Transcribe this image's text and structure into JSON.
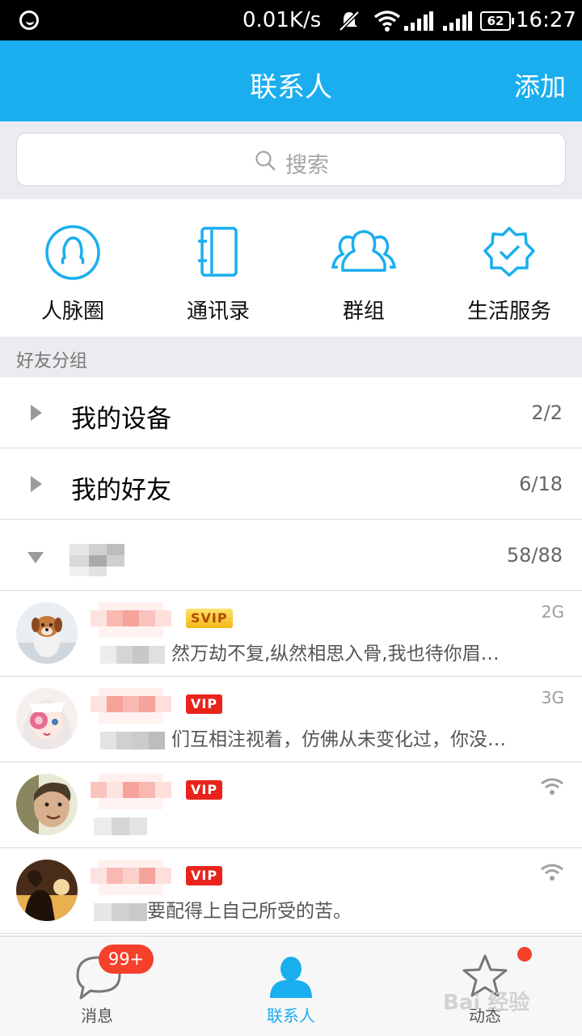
{
  "status_bar": {
    "net_speed": "0.01K/s",
    "battery": "62",
    "time": "16:27"
  },
  "header": {
    "title": "联系人",
    "add_label": "添加"
  },
  "search": {
    "placeholder": "搜索"
  },
  "quick_entries": [
    {
      "label": "人脉圈",
      "icon": "person-circle-icon"
    },
    {
      "label": "通讯录",
      "icon": "address-book-icon"
    },
    {
      "label": "群组",
      "icon": "group-icon"
    },
    {
      "label": "生活服务",
      "icon": "verified-badge-icon"
    }
  ],
  "section": {
    "title": "好友分组"
  },
  "groups": [
    {
      "name": "我的设备",
      "count": "2/2",
      "expanded": false
    },
    {
      "name": "我的好友",
      "count": "6/18",
      "expanded": false
    },
    {
      "name": "",
      "count": "58/88",
      "expanded": true
    }
  ],
  "contacts": [
    {
      "badge": "SVIP",
      "network": "2G",
      "signature": "然万劫不复,纵然相思入骨,我也待你眉…"
    },
    {
      "badge": "VIP",
      "network": "3G",
      "signature": "们互相注视着，仿佛从未变化过，你没…"
    },
    {
      "badge": "VIP",
      "network": "wifi",
      "signature": ""
    },
    {
      "badge": "VIP",
      "network": "wifi",
      "signature": "要配得上自己所受的苦。"
    }
  ],
  "bottom_nav": {
    "tabs": [
      {
        "label": "消息",
        "icon": "chat-bubble-icon"
      },
      {
        "label": "联系人",
        "icon": "contact-person-icon"
      },
      {
        "label": "动态",
        "icon": "star-icon"
      }
    ],
    "message_badge": "99+",
    "active_tab": "联系人"
  },
  "watermark": "Bai 经验",
  "colors": {
    "brand_blue": "#1aaeef",
    "vip_red": "#e8241d",
    "badge_red": "#f5402b"
  }
}
